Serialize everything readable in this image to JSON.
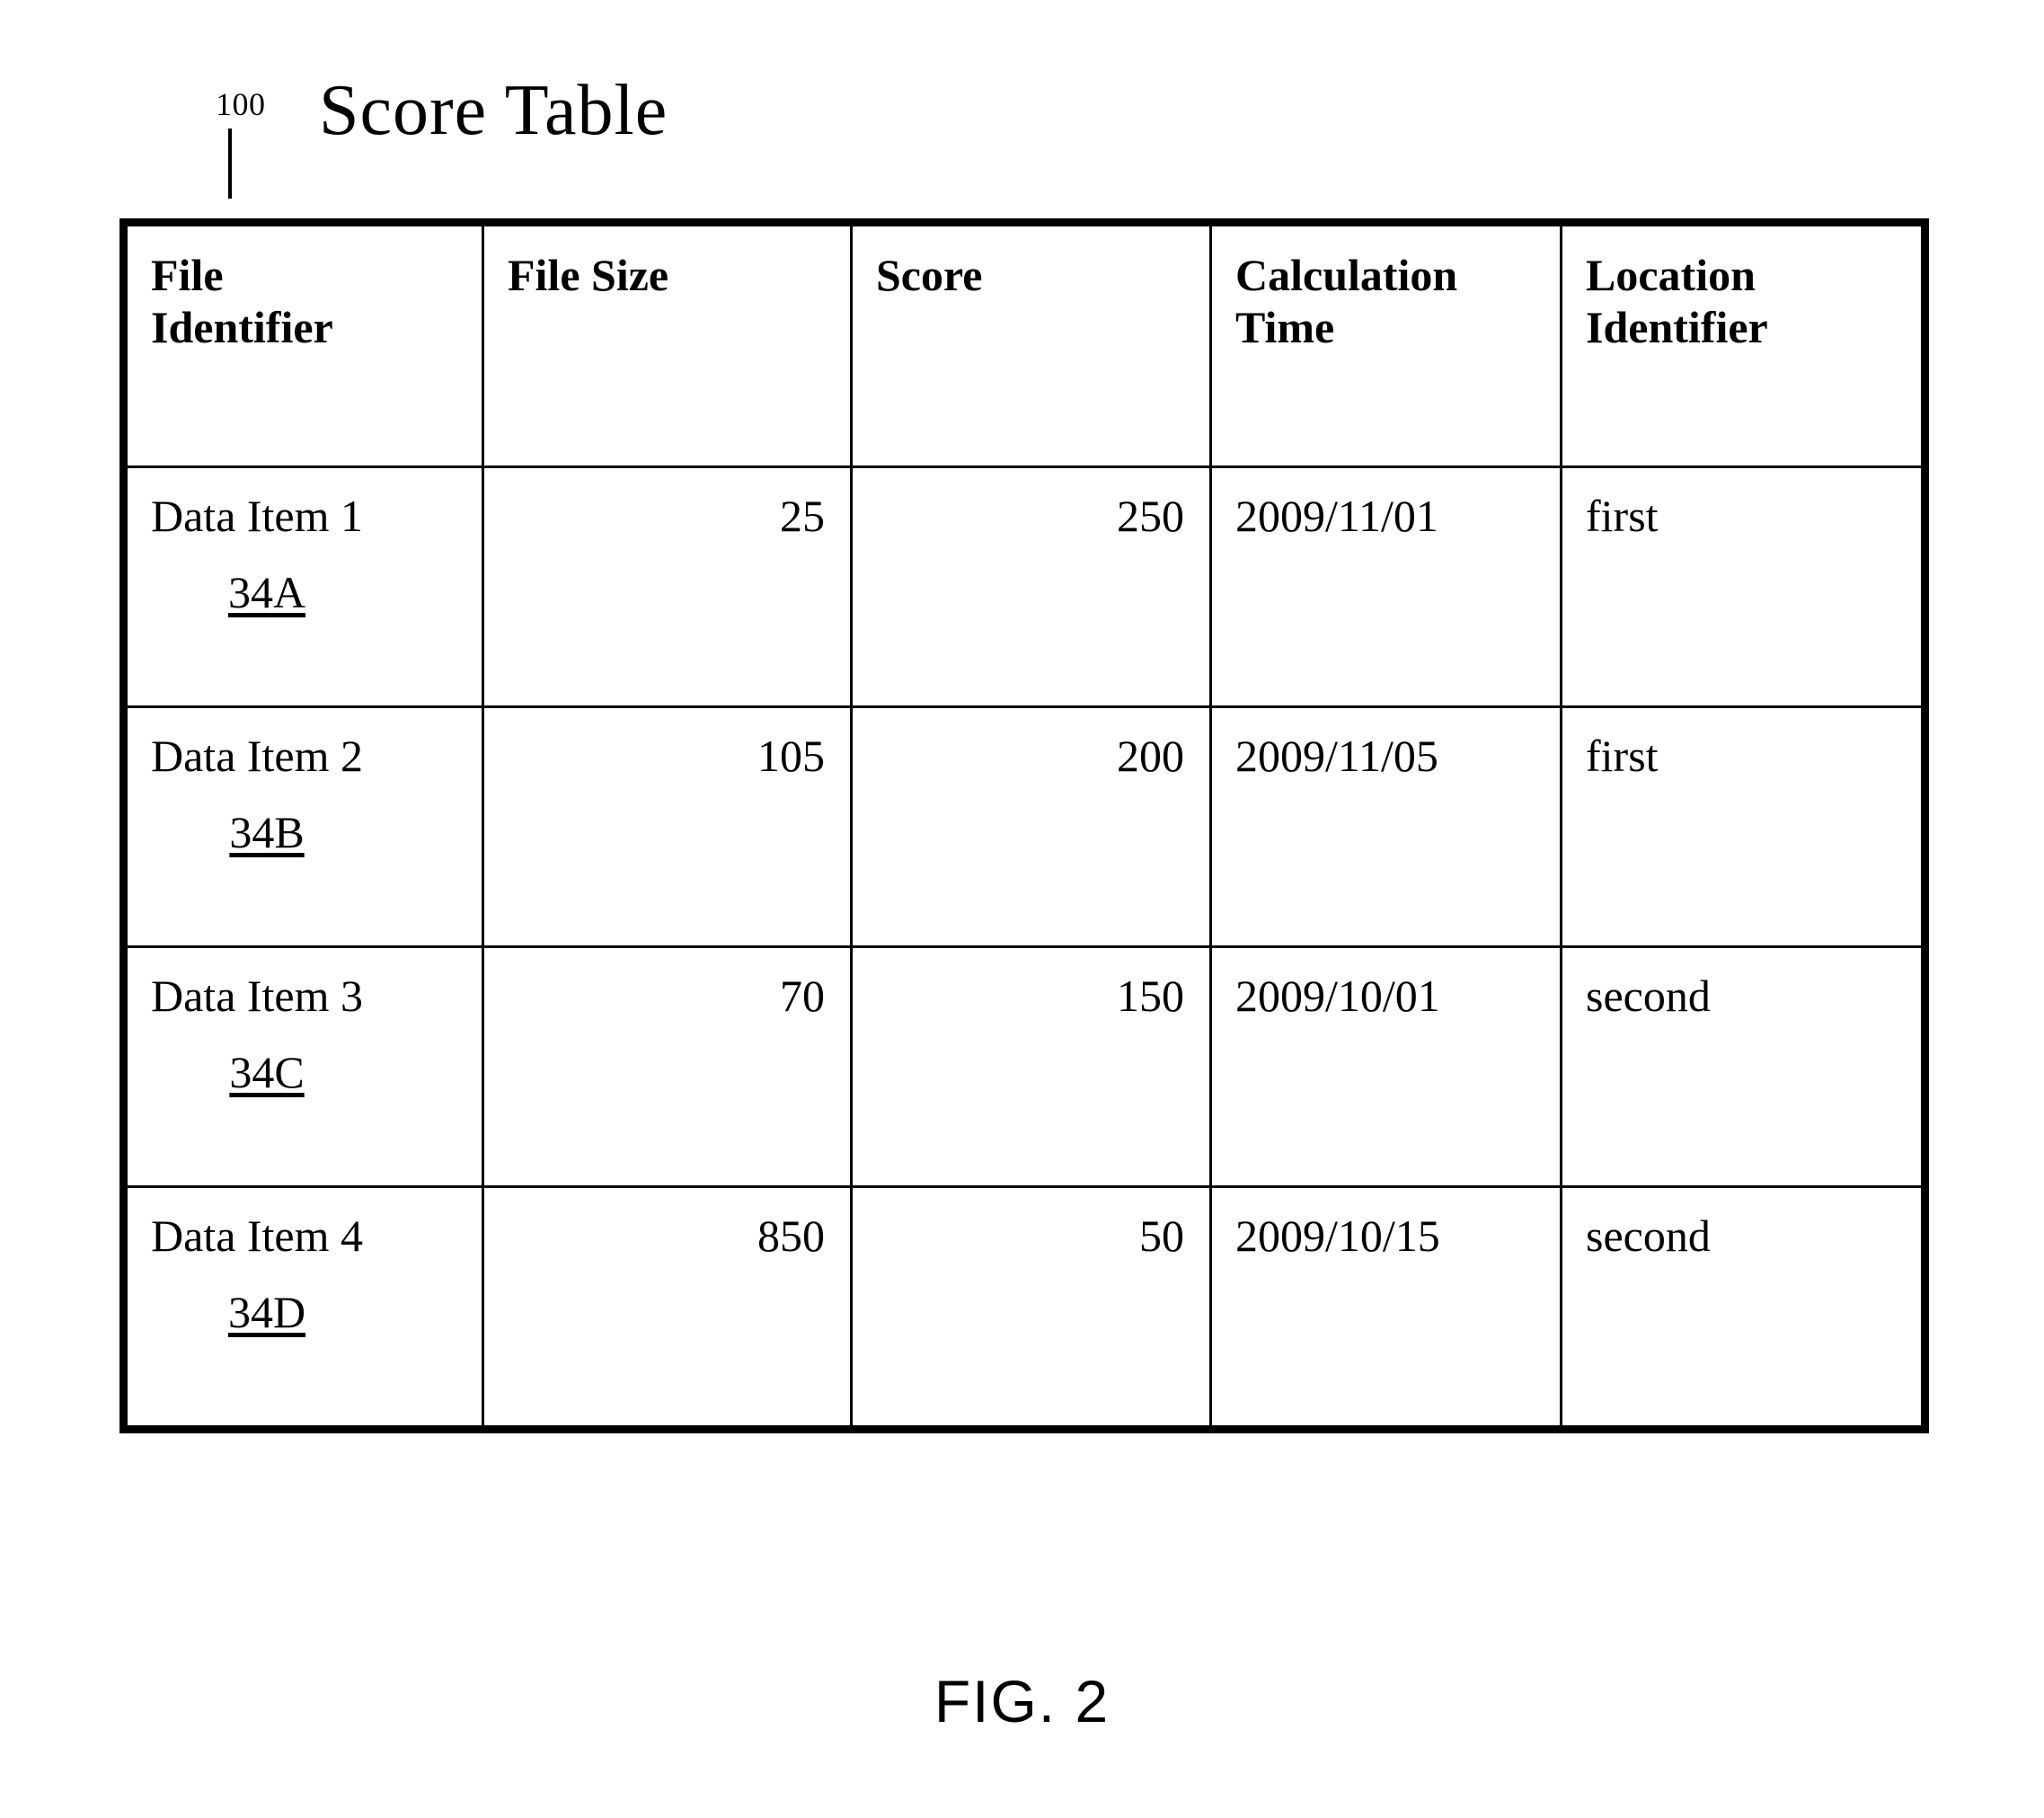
{
  "figure": {
    "title": "Score Table",
    "reference_numeral": "100",
    "caption": "FIG. 2"
  },
  "table": {
    "headers": [
      {
        "line1": "File",
        "line2": "Identifier"
      },
      {
        "line1": "File Size",
        "line2": ""
      },
      {
        "line1": "Score",
        "line2": ""
      },
      {
        "line1": "Calculation",
        "line2": "Time"
      },
      {
        "line1": "Location",
        "line2": "Identifier"
      }
    ],
    "rows": [
      {
        "file_identifier": "Data Item 1",
        "file_ref": "34A",
        "file_size": "25",
        "score": "250",
        "calculation_time": "2009/11/01",
        "location_identifier": "first"
      },
      {
        "file_identifier": "Data Item 2",
        "file_ref": "34B",
        "file_size": "105",
        "score": "200",
        "calculation_time": "2009/11/05",
        "location_identifier": "first"
      },
      {
        "file_identifier": "Data Item 3",
        "file_ref": "34C",
        "file_size": "70",
        "score": "150",
        "calculation_time": "2009/10/01",
        "location_identifier": "second"
      },
      {
        "file_identifier": "Data Item 4",
        "file_ref": "34D",
        "file_size": "850",
        "score": "50",
        "calculation_time": "2009/10/15",
        "location_identifier": "second"
      }
    ]
  },
  "colors": {
    "ink": "#000000",
    "paper": "#ffffff"
  }
}
